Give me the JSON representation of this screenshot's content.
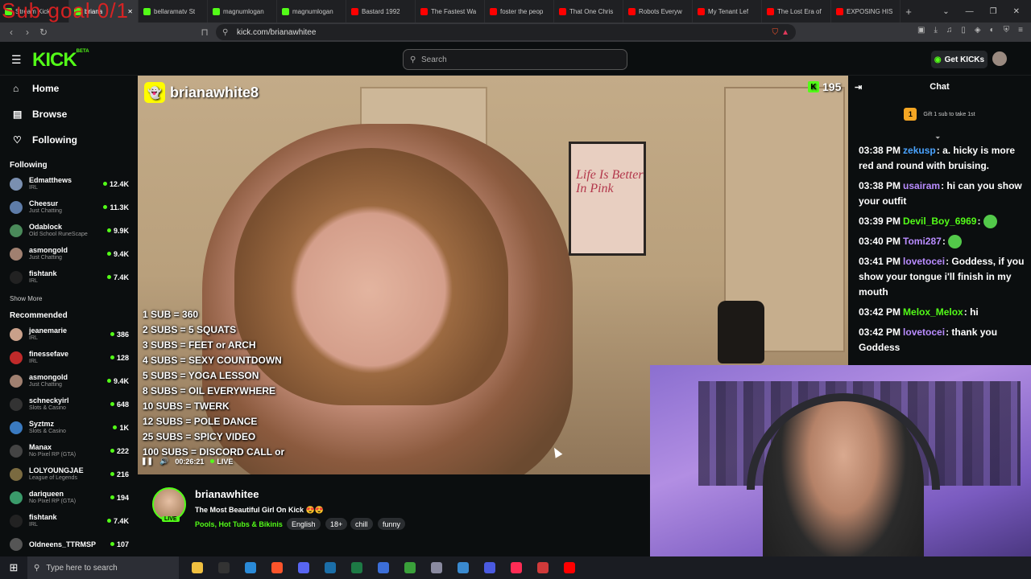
{
  "overlay": {
    "sub_goal": "Sub goal 0/1"
  },
  "browser": {
    "tabs": [
      {
        "label": "Stream Kick",
        "color": "#53fc18",
        "active": false
      },
      {
        "label": "briana",
        "color": "#53fc18",
        "active": true
      },
      {
        "label": "bellaramatv St",
        "color": "#53fc18",
        "active": false
      },
      {
        "label": "magnumlogan",
        "color": "#53fc18",
        "active": false
      },
      {
        "label": "magnumlogan",
        "color": "#53fc18",
        "active": false
      },
      {
        "label": "Bastard 1992",
        "color": "#ff0000",
        "active": false
      },
      {
        "label": "The Fastest Wa",
        "color": "#ff0000",
        "active": false
      },
      {
        "label": "foster the peop",
        "color": "#ff0000",
        "active": false
      },
      {
        "label": "That One Chris",
        "color": "#ff0000",
        "active": false
      },
      {
        "label": "Robots Everyw",
        "color": "#ff0000",
        "active": false
      },
      {
        "label": "My Tenant Lef",
        "color": "#ff0000",
        "active": false
      },
      {
        "label": "The Lost Era of",
        "color": "#ff0000",
        "active": false
      },
      {
        "label": "EXPOSING HIS",
        "color": "#ff0000",
        "active": false
      }
    ],
    "new_tab": "+",
    "url": "kick.com/brianawhitee"
  },
  "kick": {
    "logo": "KICK",
    "logo_beta": "BETA",
    "search_placeholder": "Search",
    "get_kicks": "Get KICKs",
    "nav": [
      {
        "label": "Home",
        "icon": "home-icon",
        "glyph": "⌂"
      },
      {
        "label": "Browse",
        "icon": "browse-icon",
        "glyph": "▤"
      },
      {
        "label": "Following",
        "icon": "heart-icon",
        "glyph": "♡"
      }
    ],
    "following_title": "Following",
    "following": [
      {
        "name": "Edmatthews",
        "category": "IRL",
        "viewers": "12.4K",
        "color": "#7a8fb0"
      },
      {
        "name": "Cheesur",
        "category": "Just Chatting",
        "viewers": "11.3K",
        "color": "#5e7ca8"
      },
      {
        "name": "Odablock",
        "category": "Old School RuneScape",
        "viewers": "9.9K",
        "color": "#4a8a5a"
      },
      {
        "name": "asmongold",
        "category": "Just Chatting",
        "viewers": "9.4K",
        "color": "#a08070"
      },
      {
        "name": "fishtank",
        "category": "IRL",
        "viewers": "7.4K",
        "color": "#222222"
      }
    ],
    "show_more": "Show More",
    "recommended_title": "Recommended",
    "recommended": [
      {
        "name": "jeanemarie",
        "category": "IRL",
        "viewers": "386",
        "color": "#c9a08a"
      },
      {
        "name": "finessefave",
        "category": "IRL",
        "viewers": "128",
        "color": "#c02a2a"
      },
      {
        "name": "asmongold",
        "category": "Just Chatting",
        "viewers": "9.4K",
        "color": "#a08070"
      },
      {
        "name": "schneckyirl",
        "category": "Slots & Casino",
        "viewers": "648",
        "color": "#333333"
      },
      {
        "name": "Syztmz",
        "category": "Slots & Casino",
        "viewers": "1K",
        "color": "#3a7ac0"
      },
      {
        "name": "Manax",
        "category": "No Pixel RP (GTA)",
        "viewers": "222",
        "color": "#444444"
      },
      {
        "name": "LOLYOUNGJAE",
        "category": "League of Legends",
        "viewers": "216",
        "color": "#7a6a40"
      },
      {
        "name": "dariqueen",
        "category": "No Pixel RP (GTA)",
        "viewers": "194",
        "color": "#3a9a6a"
      },
      {
        "name": "fishtank",
        "category": "IRL",
        "viewers": "7.4K",
        "color": "#222222"
      },
      {
        "name": "Oldneens_TTRMSP",
        "category": "",
        "viewers": "107",
        "color": "#555555"
      }
    ]
  },
  "video": {
    "snap_name": "brianawhite8",
    "viewers": "195",
    "poster_title": "Life Is Better In Pink",
    "goals": [
      "1 SUB = 360",
      "2 SUBS = 5 SQUATS",
      "3 SUBS = FEET or ARCH",
      "4 SUBS = SEXY COUNTDOWN",
      "5 SUBS = YOGA LESSON",
      "8 SUBS = OIL EVERYWHERE",
      "10 SUBS = TWERK",
      "12 SUBS = POLE DANCE",
      "25 SUBS = SPICY VIDEO",
      "100 SUBS = DISCORD CALL or"
    ],
    "time": "00:26:21",
    "live": "LIVE"
  },
  "stream": {
    "channel": "brianawhitee",
    "title": "The Most Beautiful Girl On Kick 😍😍",
    "category": "Pools, Hot Tubs & Bikinis",
    "live_badge": "LIVE",
    "tags": [
      "English",
      "18+",
      "chill",
      "funny"
    ]
  },
  "chat": {
    "title": "Chat",
    "gift_count": "1",
    "gift_text": "Gift 1 sub to take 1st",
    "messages": [
      {
        "time": "03:38 PM",
        "user": "zekusp",
        "color": "#4aa3ff",
        "text": "a. hicky is more red and round with bruising."
      },
      {
        "time": "03:38 PM",
        "user": "usairam",
        "color": "#b98cff",
        "text": "hi can you show your outfit"
      },
      {
        "time": "03:39 PM",
        "user": "Devil_Boy_6969",
        "color": "#53fc18",
        "text": "",
        "emote": true
      },
      {
        "time": "03:40 PM",
        "user": "Tomi287",
        "color": "#b98cff",
        "text": "",
        "emote": true
      },
      {
        "time": "03:41 PM",
        "user": "lovetocei",
        "color": "#b98cff",
        "text": "Goddess, if you show your tongue i'll finish in my mouth"
      },
      {
        "time": "03:42 PM",
        "user": "Melox_Melox",
        "color": "#53fc18",
        "text": "hi"
      },
      {
        "time": "03:42 PM",
        "user": "lovetocei",
        "color": "#b98cff",
        "text": "thank you Goddess"
      }
    ]
  },
  "taskbar": {
    "search_placeholder": "Type here to search",
    "apps": [
      {
        "icon": "file-explorer-icon",
        "color": "#f0c040"
      },
      {
        "icon": "epic-games-icon",
        "color": "#333333"
      },
      {
        "icon": "app-blue-icon",
        "color": "#2a8ad8"
      },
      {
        "icon": "brave-browser-icon",
        "color": "#fb542b"
      },
      {
        "icon": "discord-icon",
        "color": "#5865f2"
      },
      {
        "icon": "steam-icon",
        "color": "#1b6ea8"
      },
      {
        "icon": "excel-icon",
        "color": "#1d7a45"
      },
      {
        "icon": "app-window-icon",
        "color": "#3c6ed8"
      },
      {
        "icon": "xbox-icon",
        "color": "#3aa03a"
      },
      {
        "icon": "shield-app-icon",
        "color": "#8a8aa0"
      },
      {
        "icon": "notepad-icon",
        "color": "#3a8ad0"
      },
      {
        "icon": "messenger-icon",
        "color": "#4a5ae0"
      },
      {
        "icon": "tiktok-icon",
        "color": "#fe2c55"
      },
      {
        "icon": "app-red-icon",
        "color": "#d03a3a"
      },
      {
        "icon": "youtube-icon",
        "color": "#ff0000"
      }
    ]
  }
}
